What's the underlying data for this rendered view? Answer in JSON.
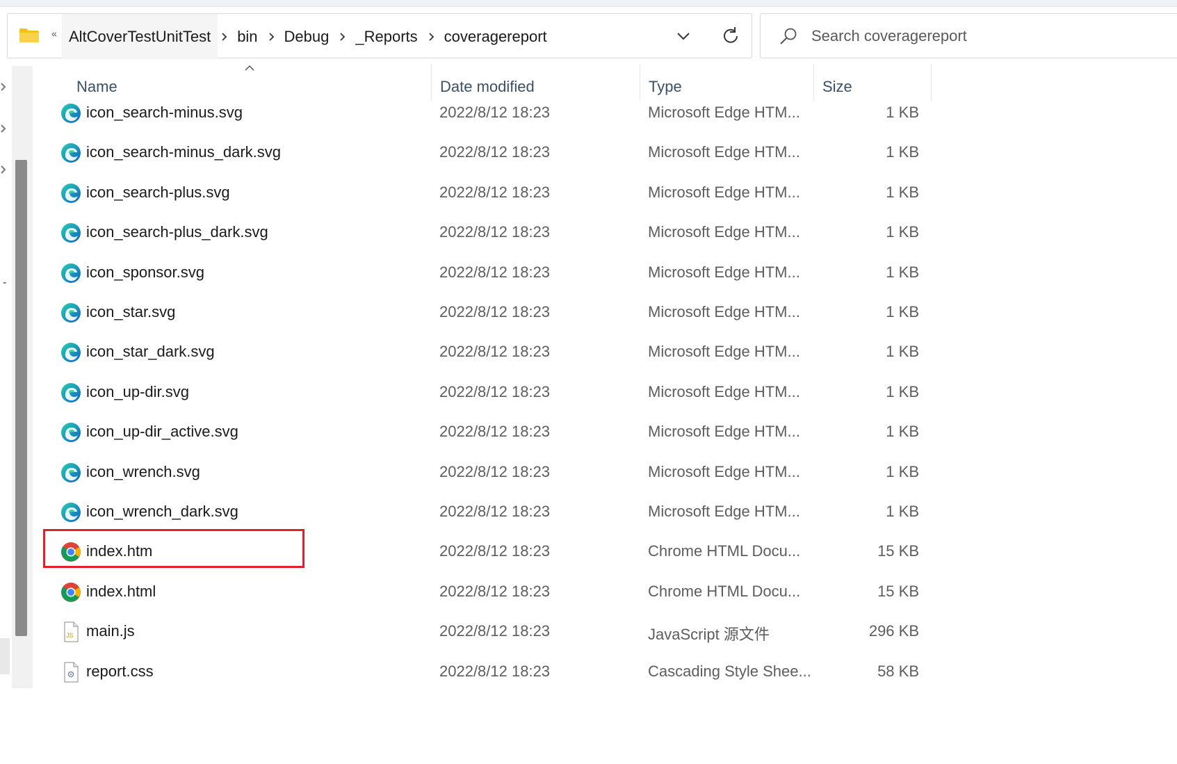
{
  "address_bar": {
    "overflow_glyph": "«",
    "breadcrumbs": [
      "AltCoverTestUnitTest",
      "bin",
      "Debug",
      "_Reports",
      "coveragereport"
    ]
  },
  "search": {
    "placeholder": "Search coveragereport"
  },
  "columns": {
    "name": "Name",
    "date": "Date modified",
    "type": "Type",
    "size": "Size"
  },
  "files": [
    {
      "name": "icon_search-minus.svg",
      "date": "2022/8/12 18:23",
      "type": "Microsoft Edge HTM...",
      "size": "1 KB",
      "icon": "edge-icon"
    },
    {
      "name": "icon_search-minus_dark.svg",
      "date": "2022/8/12 18:23",
      "type": "Microsoft Edge HTM...",
      "size": "1 KB",
      "icon": "edge-icon"
    },
    {
      "name": "icon_search-plus.svg",
      "date": "2022/8/12 18:23",
      "type": "Microsoft Edge HTM...",
      "size": "1 KB",
      "icon": "edge-icon"
    },
    {
      "name": "icon_search-plus_dark.svg",
      "date": "2022/8/12 18:23",
      "type": "Microsoft Edge HTM...",
      "size": "1 KB",
      "icon": "edge-icon"
    },
    {
      "name": "icon_sponsor.svg",
      "date": "2022/8/12 18:23",
      "type": "Microsoft Edge HTM...",
      "size": "1 KB",
      "icon": "edge-icon"
    },
    {
      "name": "icon_star.svg",
      "date": "2022/8/12 18:23",
      "type": "Microsoft Edge HTM...",
      "size": "1 KB",
      "icon": "edge-icon"
    },
    {
      "name": "icon_star_dark.svg",
      "date": "2022/8/12 18:23",
      "type": "Microsoft Edge HTM...",
      "size": "1 KB",
      "icon": "edge-icon"
    },
    {
      "name": "icon_up-dir.svg",
      "date": "2022/8/12 18:23",
      "type": "Microsoft Edge HTM...",
      "size": "1 KB",
      "icon": "edge-icon"
    },
    {
      "name": "icon_up-dir_active.svg",
      "date": "2022/8/12 18:23",
      "type": "Microsoft Edge HTM...",
      "size": "1 KB",
      "icon": "edge-icon"
    },
    {
      "name": "icon_wrench.svg",
      "date": "2022/8/12 18:23",
      "type": "Microsoft Edge HTM...",
      "size": "1 KB",
      "icon": "edge-icon"
    },
    {
      "name": "icon_wrench_dark.svg",
      "date": "2022/8/12 18:23",
      "type": "Microsoft Edge HTM...",
      "size": "1 KB",
      "icon": "edge-icon"
    },
    {
      "name": "index.htm",
      "date": "2022/8/12 18:23",
      "type": "Chrome HTML Docu...",
      "size": "15 KB",
      "icon": "chrome-icon",
      "highlighted": true
    },
    {
      "name": "index.html",
      "date": "2022/8/12 18:23",
      "type": "Chrome HTML Docu...",
      "size": "15 KB",
      "icon": "chrome-icon"
    },
    {
      "name": "main.js",
      "date": "2022/8/12 18:23",
      "type": "JavaScript 源文件",
      "size": "296 KB",
      "icon": "js-file-icon"
    },
    {
      "name": "report.css",
      "date": "2022/8/12 18:23",
      "type": "Cascading Style Shee...",
      "size": "58 KB",
      "icon": "css-file-icon"
    }
  ],
  "colors": {
    "highlight_border": "#e0202a",
    "header_text": "#3b4f66",
    "folder_yellow": "#f2c21b"
  }
}
